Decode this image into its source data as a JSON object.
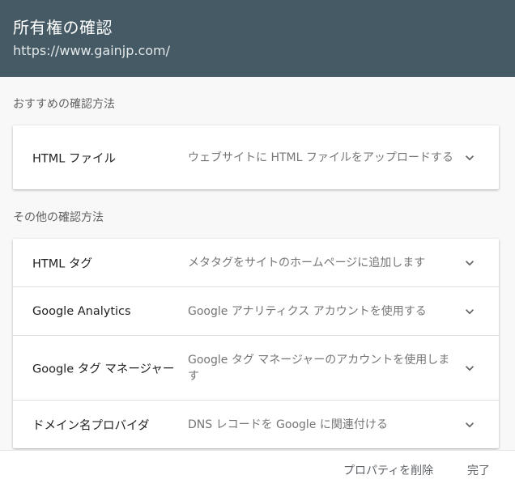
{
  "header": {
    "title": "所有権の確認",
    "url": "https://www.gainjp.com/"
  },
  "recommended": {
    "label": "おすすめの確認方法",
    "items": [
      {
        "title": "HTML ファイル",
        "desc": "ウェブサイトに HTML ファイルをアップロードする",
        "icon": "chevron-down-icon"
      }
    ]
  },
  "other": {
    "label": "その他の確認方法",
    "items": [
      {
        "title": "HTML タグ",
        "desc": "メタタグをサイトのホームページに追加します",
        "icon": "chevron-down-icon"
      },
      {
        "title": "Google Analytics",
        "desc": "Google アナリティクス アカウントを使用する",
        "icon": "chevron-down-icon"
      },
      {
        "title": "Google タグ マネージャー",
        "desc": "Google タグ マネージャーのアカウントを使用します",
        "icon": "chevron-down-icon"
      },
      {
        "title": "ドメイン名プロバイダ",
        "desc": "DNS レコードを Google に関連付ける",
        "icon": "chevron-down-icon"
      }
    ]
  },
  "footer": {
    "delete_label": "プロパティを削除",
    "done_label": "完了"
  },
  "colors": {
    "header_bg": "#455a64",
    "content_bg": "#f8f8f8"
  }
}
